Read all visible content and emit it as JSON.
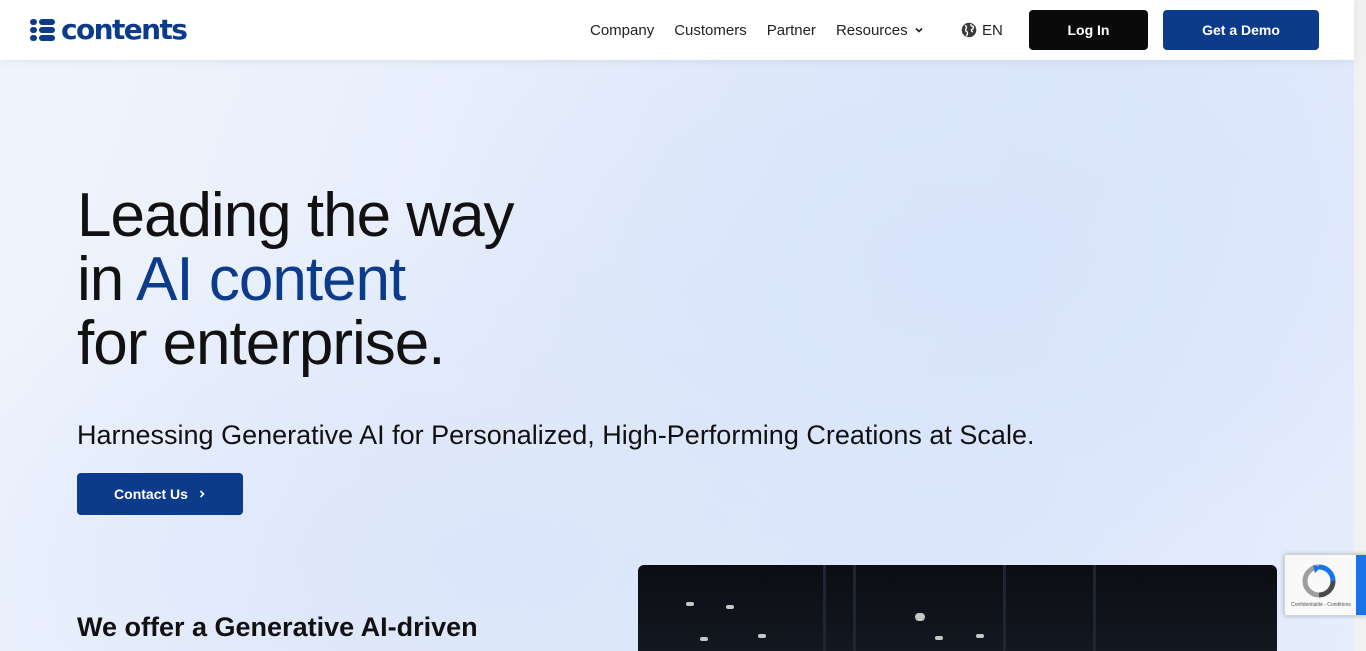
{
  "header": {
    "logo_text": "contents",
    "nav": [
      {
        "label": "Company"
      },
      {
        "label": "Customers"
      },
      {
        "label": "Partner"
      },
      {
        "label": "Resources"
      }
    ],
    "language": "EN",
    "login_label": "Log In",
    "demo_label": "Get a Demo"
  },
  "hero": {
    "title_line1": "Leading the way",
    "title_line2_prefix": "in ",
    "title_line2_accent": "AI content",
    "title_line3": "for enterprise.",
    "subtitle": "Harnessing Generative AI for Personalized, High-Performing Creations at Scale.",
    "cta_label": "Contact Us"
  },
  "section": {
    "heading": "We offer a Generative AI-driven"
  },
  "recaptcha": {
    "terms": "Confidentialité - Conditions"
  },
  "colors": {
    "brand": "#0d3b8c",
    "login_bg": "#0a0a0a",
    "text": "#111111"
  },
  "icons": {
    "logo": "list-icon",
    "resources_caret": "chevron-down-icon",
    "language": "globe-icon",
    "cta_arrow": "chevron-right-icon",
    "recaptcha": "recaptcha-icon"
  }
}
